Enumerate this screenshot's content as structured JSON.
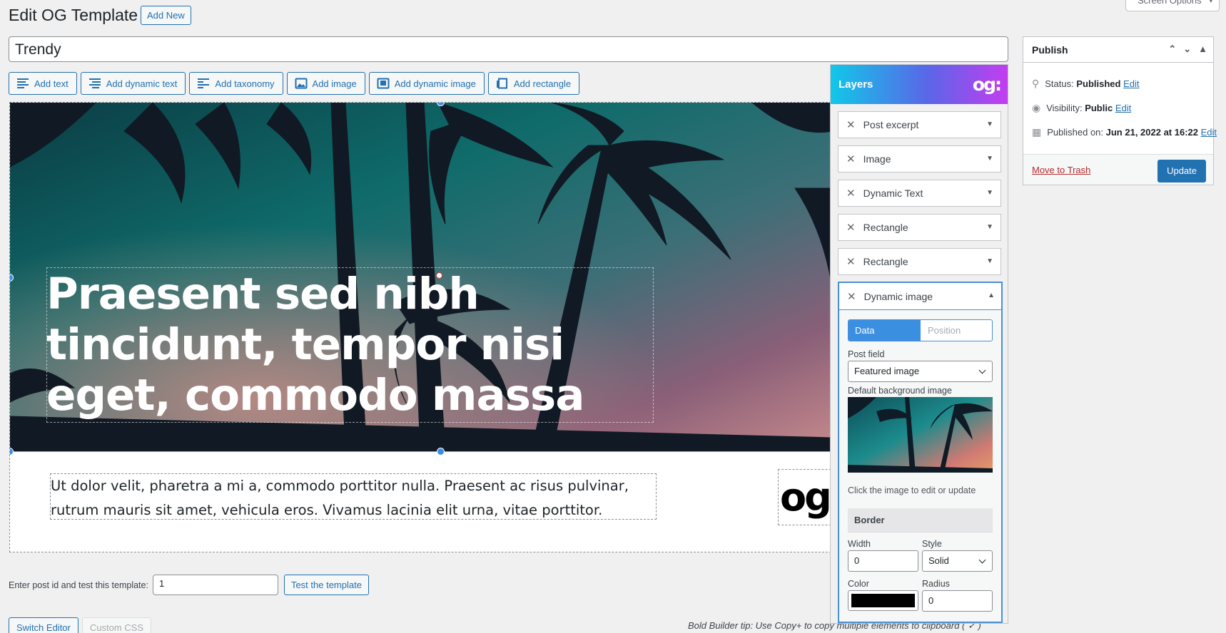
{
  "header": {
    "title": "Edit OG Template",
    "add_new": "Add New",
    "screen_options": "Screen Options"
  },
  "post_title": "Trendy",
  "toolbar": [
    {
      "label": "Add text",
      "icon": "text-lines-icon"
    },
    {
      "label": "Add dynamic text",
      "icon": "dynamic-text-icon"
    },
    {
      "label": "Add taxonomy",
      "icon": "taxonomy-icon"
    },
    {
      "label": "Add image",
      "icon": "image-icon"
    },
    {
      "label": "Add dynamic image",
      "icon": "dynamic-image-icon"
    },
    {
      "label": "Add rectangle",
      "icon": "rectangle-icon"
    }
  ],
  "canvas": {
    "headline": "Praesent sed nibh tincidunt, tempor nisi eget, commodo massa",
    "excerpt": "Ut dolor velit, pharetra a mi a, commodo porttitor nulla. Praesent ac risus pulvinar, rutrum mauris sit amet, vehicula eros. Vivamus lacinia elit urna, vitae porttitor.",
    "logo": "og:"
  },
  "test": {
    "label": "Enter post id and test this template:",
    "value": "1",
    "button": "Test the template"
  },
  "footer": {
    "switch_editor": "Switch Editor",
    "custom_css": "Custom CSS",
    "tip": "Bold Builder tip: Use Copy+ to copy multiple elements to clipboard ( ✓ )"
  },
  "layers": {
    "title": "Layers",
    "logo": "og:",
    "items": [
      {
        "label": "Post excerpt"
      },
      {
        "label": "Image"
      },
      {
        "label": "Dynamic Text"
      },
      {
        "label": "Rectangle"
      },
      {
        "label": "Rectangle"
      }
    ],
    "open_item": {
      "label": "Dynamic image",
      "tab_data": "Data",
      "tab_position": "Position",
      "post_field_label": "Post field",
      "post_field_value": "Featured image",
      "default_bg_label": "Default background image",
      "helper": "Click the image to edit or update",
      "border_title": "Border",
      "width_label": "Width",
      "width_value": "0",
      "style_label": "Style",
      "style_value": "Solid",
      "color_label": "Color",
      "color_value": "#000000",
      "radius_label": "Radius",
      "radius_value": "0"
    }
  },
  "publish": {
    "title": "Publish",
    "status_label": "Status:",
    "status_value": "Published",
    "visibility_label": "Visibility:",
    "visibility_value": "Public",
    "published_label": "Published on:",
    "published_value": "Jun 21, 2022 at 16:22",
    "edit": "Edit",
    "trash": "Move to Trash",
    "update": "Update"
  },
  "colors": {
    "accent": "#2271b1",
    "layers_gradient_start": "#10c8e8",
    "layers_gradient_end": "#c33df0",
    "selection": "#3b8de8"
  }
}
